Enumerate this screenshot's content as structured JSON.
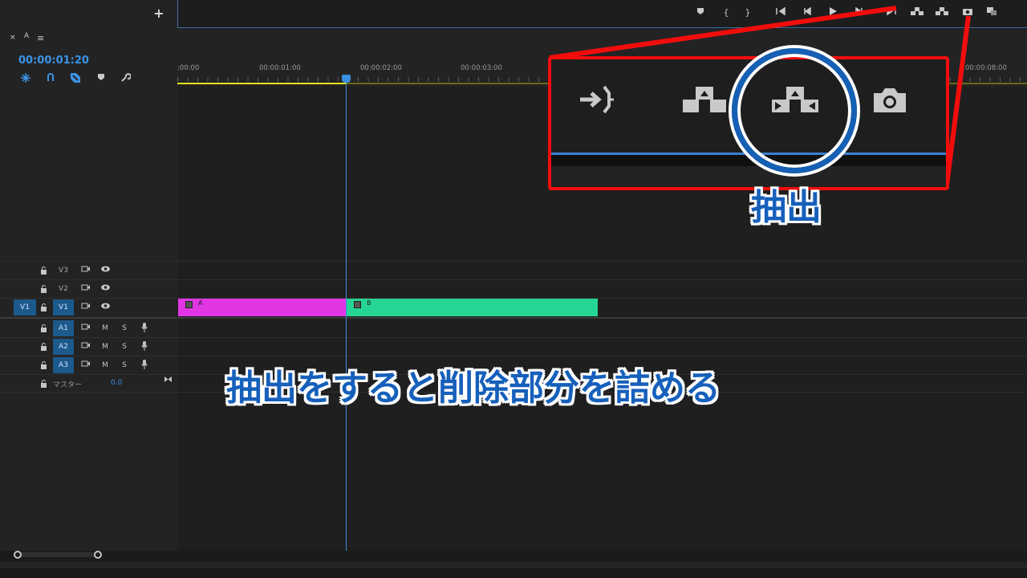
{
  "topbar": {
    "add_label": "+",
    "icons": [
      "marker-icon",
      "mark-in-icon",
      "mark-out-icon",
      "go-to-in-icon",
      "step-back-icon",
      "play-icon",
      "step-forward-icon",
      "go-to-out-icon",
      "lift-icon",
      "extract-icon",
      "export-frame-icon",
      "compare-icon"
    ]
  },
  "panel": {
    "close_label": "×",
    "sequence_name": "A",
    "menu_label": "≡",
    "timecode": "00:00:01:20"
  },
  "ruler": {
    "labels": [
      ":00:00",
      "00:00:01:00",
      "00:00:02:00",
      "00:00:03:00",
      "00:00:08:00"
    ]
  },
  "tracks": {
    "video": [
      {
        "name": "V3",
        "source": ""
      },
      {
        "name": "V2",
        "source": ""
      },
      {
        "name": "V1",
        "source": "V1"
      }
    ],
    "audio": [
      {
        "name": "A1",
        "m": "M",
        "s": "S"
      },
      {
        "name": "A2",
        "m": "M",
        "s": "S"
      },
      {
        "name": "A3",
        "m": "M",
        "s": "S"
      }
    ],
    "master_label": "マスター",
    "master_value": "0.0"
  },
  "clips": {
    "a_label": "A",
    "b_label": "B",
    "a_color": "#e236e5",
    "b_color": "#26d594"
  },
  "annotation": {
    "callout_title": "抽出",
    "caption": "抽出をすると削除部分を詰める",
    "highlight_color": "#f20d0d",
    "text_color": "#1660bb"
  }
}
